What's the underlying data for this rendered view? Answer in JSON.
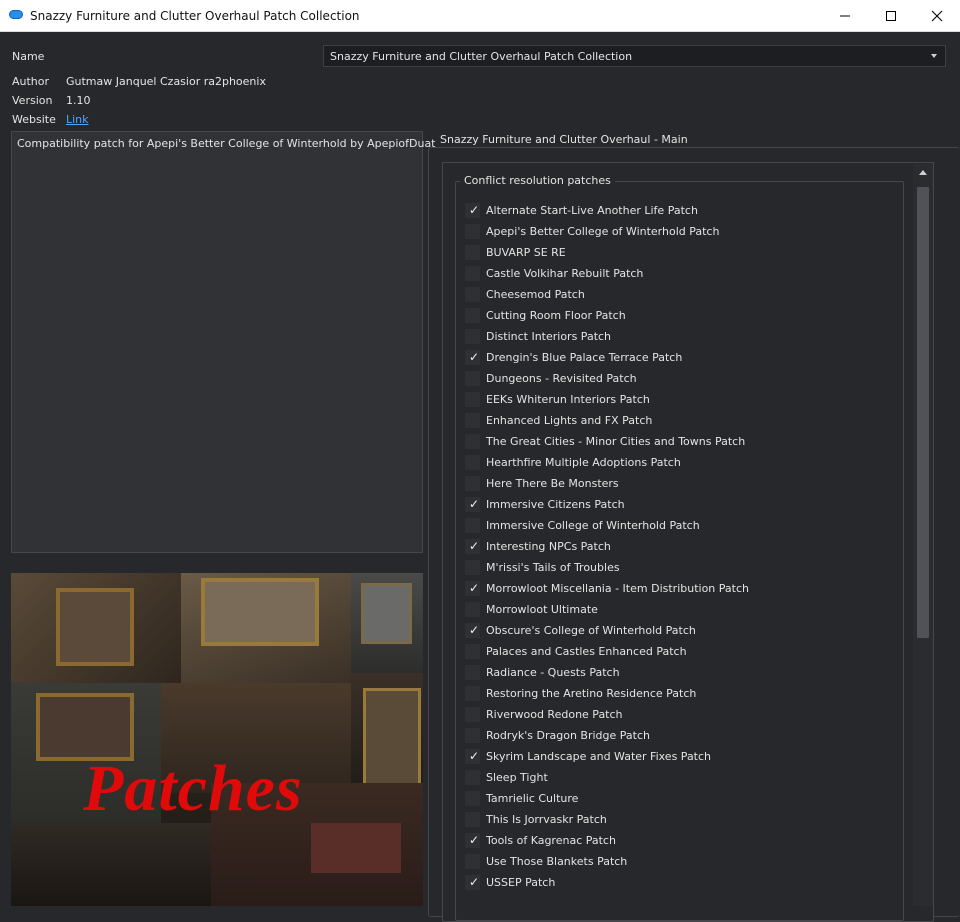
{
  "window": {
    "title": "Snazzy Furniture and Clutter Overhaul Patch Collection"
  },
  "info": {
    "name_label": "Name",
    "name_value": "Snazzy Furniture and Clutter Overhaul Patch Collection",
    "author_label": "Author",
    "author_value": "Gutmaw Janquel Czasior ra2phoenix",
    "version_label": "Version",
    "version_value": "1.10",
    "website_label": "Website",
    "website_link": "Link",
    "description": "Compatibility patch for Apepi's Better College of Winterhold by ApepiofDuat"
  },
  "preview": {
    "overlay_text": "Patches"
  },
  "main_group": {
    "title": "Snazzy Furniture and Clutter Overhaul - Main",
    "sub_group_title": "Conflict resolution patches",
    "items": [
      {
        "label": "Alternate Start-Live Another Life Patch",
        "checked": true
      },
      {
        "label": "Apepi's Better College of Winterhold Patch",
        "checked": false
      },
      {
        "label": "BUVARP SE RE",
        "checked": false
      },
      {
        "label": "Castle Volkihar Rebuilt Patch",
        "checked": false
      },
      {
        "label": "Cheesemod Patch",
        "checked": false
      },
      {
        "label": "Cutting Room Floor Patch",
        "checked": false
      },
      {
        "label": "Distinct Interiors Patch",
        "checked": false
      },
      {
        "label": "Drengin's Blue Palace Terrace Patch",
        "checked": true
      },
      {
        "label": "Dungeons - Revisited Patch",
        "checked": false
      },
      {
        "label": "EEKs Whiterun Interiors Patch",
        "checked": false
      },
      {
        "label": "Enhanced Lights and FX Patch",
        "checked": false
      },
      {
        "label": "The Great Cities - Minor Cities and Towns Patch",
        "checked": false
      },
      {
        "label": "Hearthfire Multiple Adoptions Patch",
        "checked": false
      },
      {
        "label": "Here There Be Monsters",
        "checked": false
      },
      {
        "label": "Immersive Citizens Patch",
        "checked": true
      },
      {
        "label": "Immersive College of Winterhold Patch",
        "checked": false
      },
      {
        "label": "Interesting NPCs Patch",
        "checked": true
      },
      {
        "label": "M'rissi's Tails of Troubles",
        "checked": false
      },
      {
        "label": "Morrowloot Miscellania - Item Distribution Patch",
        "checked": true
      },
      {
        "label": "Morrowloot Ultimate",
        "checked": false
      },
      {
        "label": "Obscure's College of Winterhold Patch",
        "checked": true
      },
      {
        "label": "Palaces and Castles Enhanced Patch",
        "checked": false
      },
      {
        "label": "Radiance - Quests Patch",
        "checked": false
      },
      {
        "label": "Restoring the Aretino Residence Patch",
        "checked": false
      },
      {
        "label": "Riverwood Redone Patch",
        "checked": false
      },
      {
        "label": "Rodryk's Dragon Bridge Patch",
        "checked": false
      },
      {
        "label": "Skyrim Landscape and Water Fixes Patch",
        "checked": true
      },
      {
        "label": "Sleep Tight",
        "checked": false
      },
      {
        "label": "Tamrielic Culture",
        "checked": false
      },
      {
        "label": "This Is Jorrvaskr Patch",
        "checked": false
      },
      {
        "label": "Tools of Kagrenac Patch",
        "checked": true
      },
      {
        "label": "Use Those Blankets Patch",
        "checked": false
      },
      {
        "label": "USSEP Patch",
        "checked": true
      }
    ]
  },
  "colors": {
    "background": "#27282b",
    "link": "#4ea3ff",
    "overlay_text": "#e00a0a"
  },
  "icons": {
    "check_mark": "✓"
  }
}
